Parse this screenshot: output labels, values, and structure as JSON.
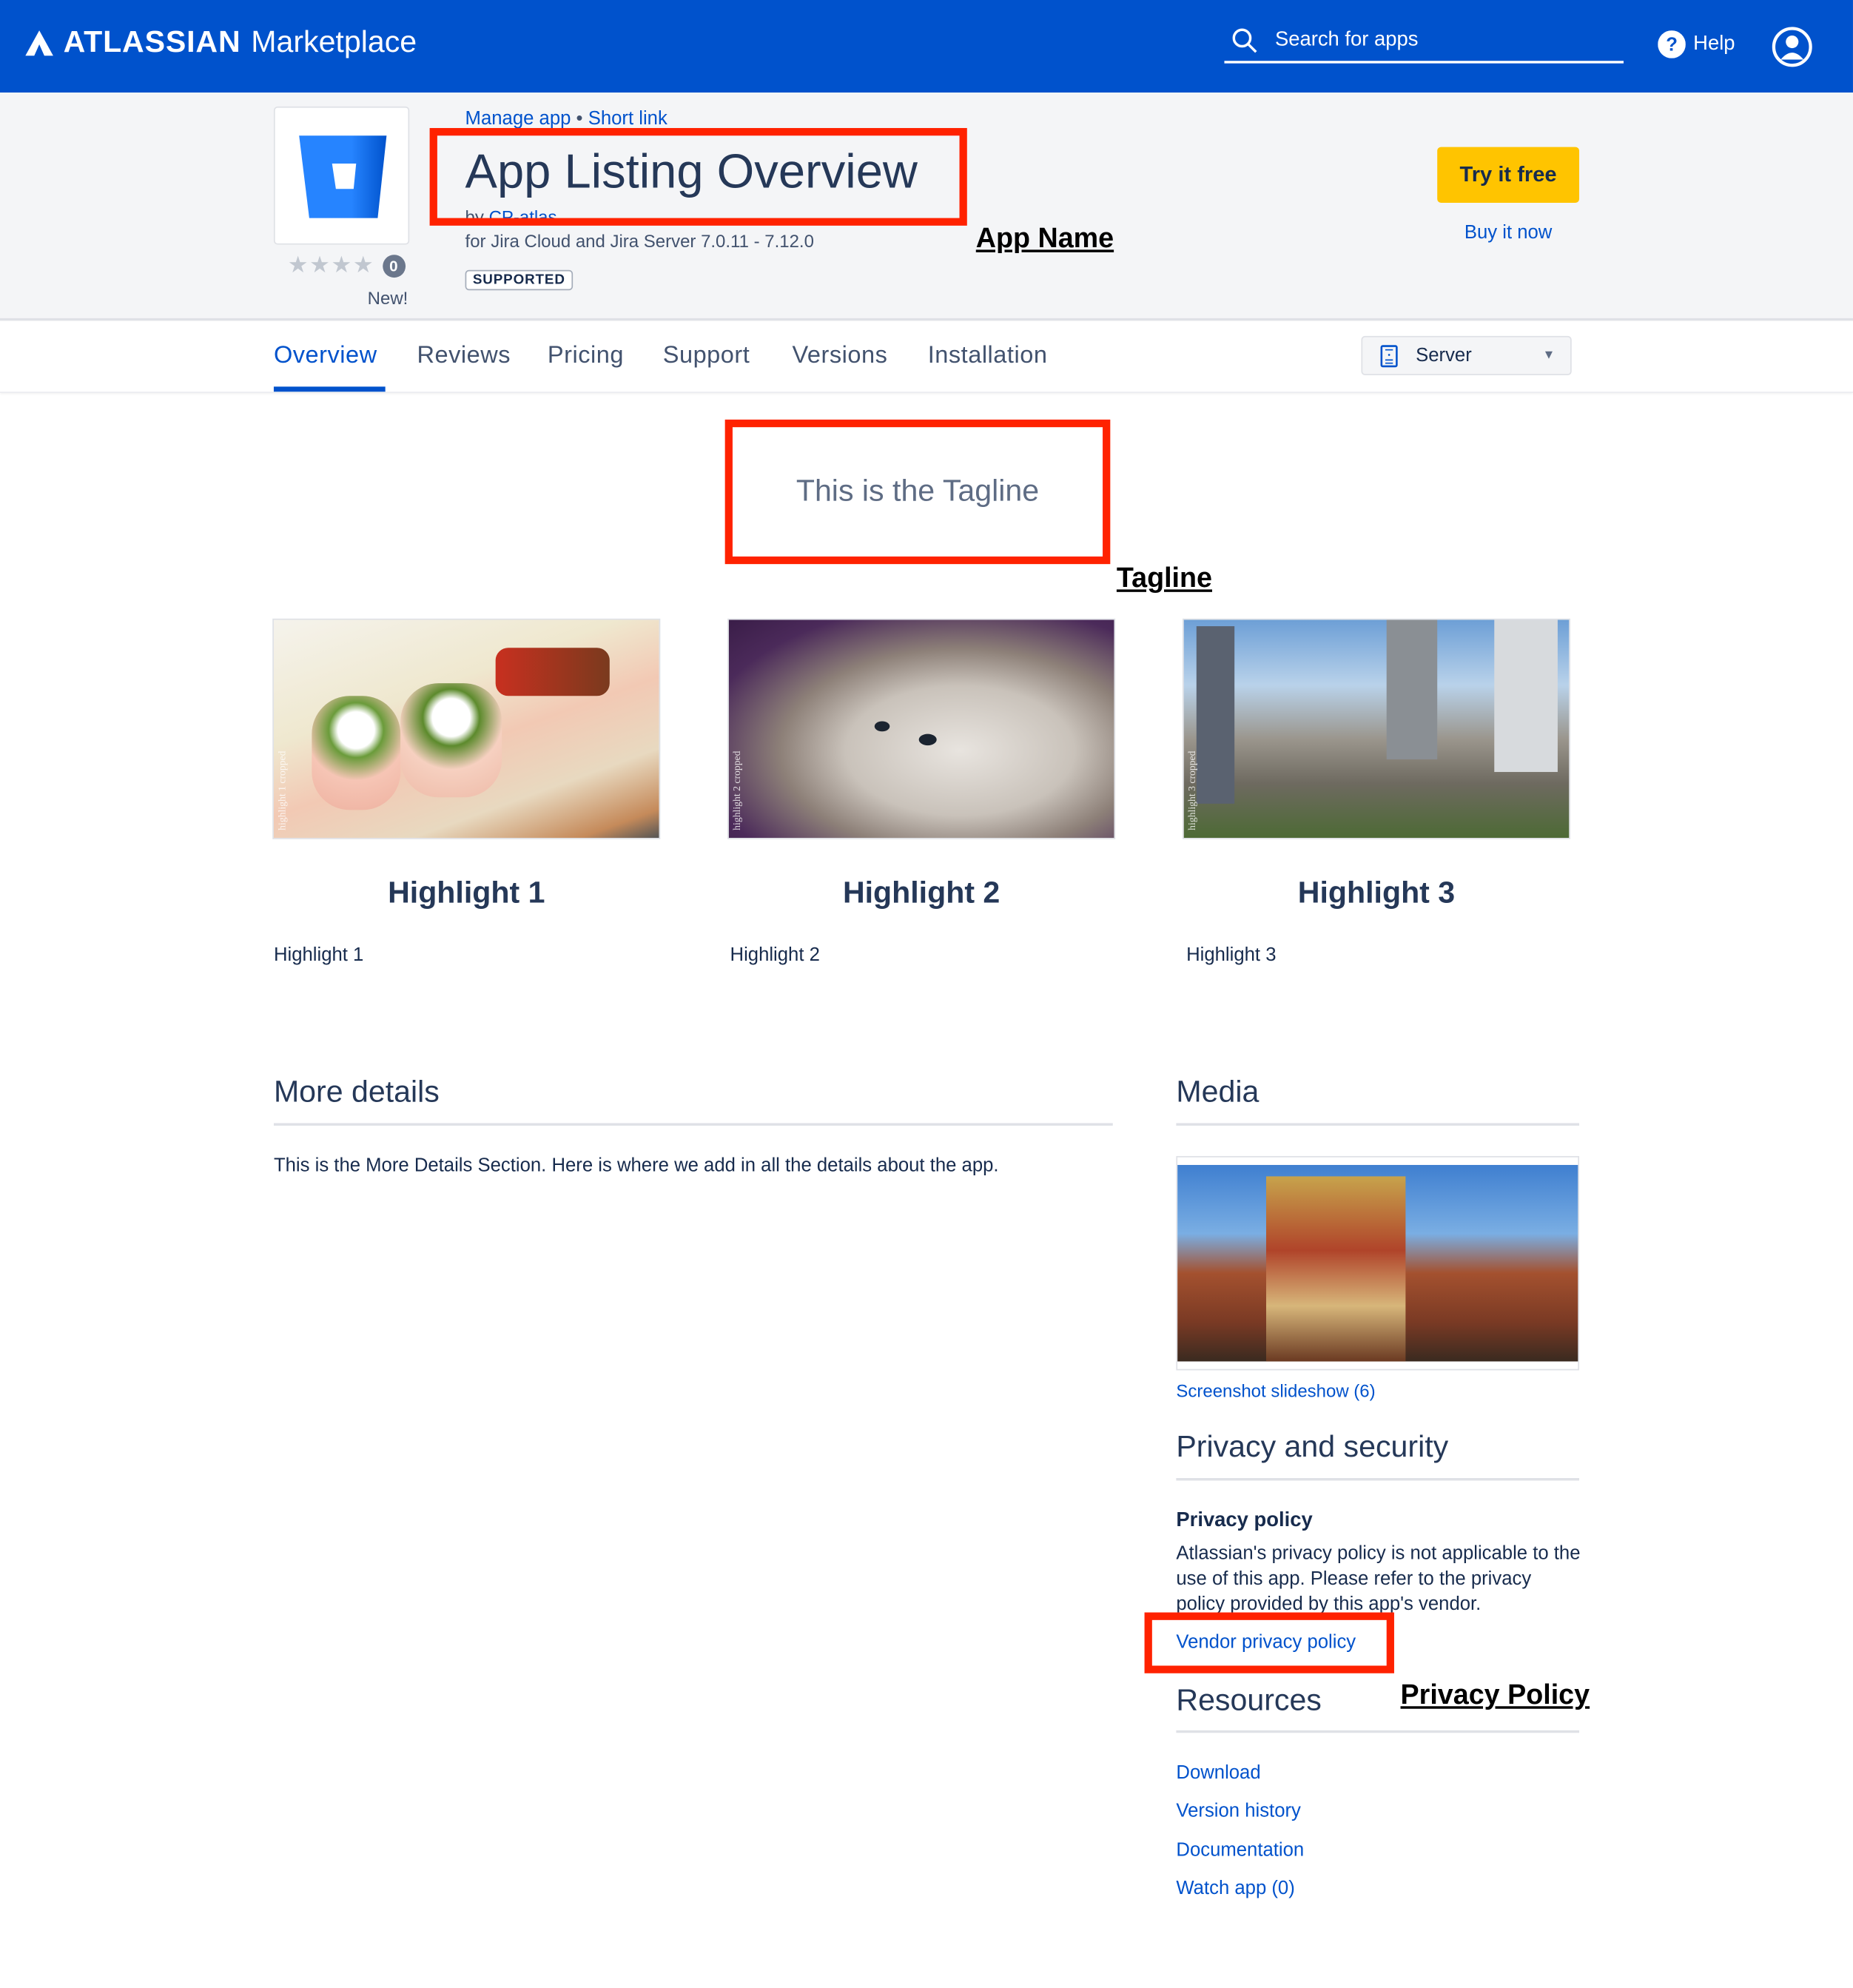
{
  "header": {
    "brand_bold": "ATLASSIAN",
    "brand": "Marketplace",
    "search_placeholder": "Search for apps",
    "help": "Help",
    "color": "#0052cc"
  },
  "app": {
    "manage_app": "Manage app",
    "separator": "•",
    "short_link": "Short link",
    "title": "App Listing Overview",
    "by": "by",
    "vendor": "CP-atlas",
    "compatibility": "for Jira Cloud and Jira Server 7.0.11 - 7.12.0",
    "badge": "SUPPORTED",
    "stars": "★★★★",
    "rating_fraction": 0,
    "review_count": "0",
    "new_label": "New!",
    "try_free": "Try it free",
    "buy_now": "Buy it now"
  },
  "annotations": {
    "app_name": "App Name",
    "tagline": "Tagline",
    "privacy_policy": "Privacy Policy",
    "color": "#ff2200"
  },
  "tabs": [
    {
      "label": "Overview",
      "active": true
    },
    {
      "label": "Reviews"
    },
    {
      "label": "Pricing"
    },
    {
      "label": "Support"
    },
    {
      "label": "Versions"
    },
    {
      "label": "Installation"
    }
  ],
  "hosting_select": {
    "value": "Server"
  },
  "tagline": "This is the Tagline",
  "highlights": [
    {
      "title": "Highlight 1",
      "text": "Highlight 1",
      "watermark": "highlight 1 cropped"
    },
    {
      "title": "Highlight 2",
      "text": "Highlight 2",
      "watermark": "highlight 2 cropped"
    },
    {
      "title": "Highlight 3",
      "text": "Highlight 3",
      "watermark": "highlight 3 cropped"
    }
  ],
  "more_details": {
    "heading": "More details",
    "body": "This is the More Details Section. Here is where we add in all the details about the app."
  },
  "media": {
    "heading": "Media",
    "slideshow": "Screenshot slideshow (6)"
  },
  "privacy": {
    "heading": "Privacy and security",
    "subheading": "Privacy policy",
    "body": "Atlassian's privacy policy is not applicable to the use of this app. Please refer to the privacy policy provided by this app's vendor.",
    "link": "Vendor privacy policy"
  },
  "resources": {
    "heading": "Resources",
    "links": [
      "Download",
      "Version history",
      "Documentation",
      "Watch app (0)"
    ]
  }
}
